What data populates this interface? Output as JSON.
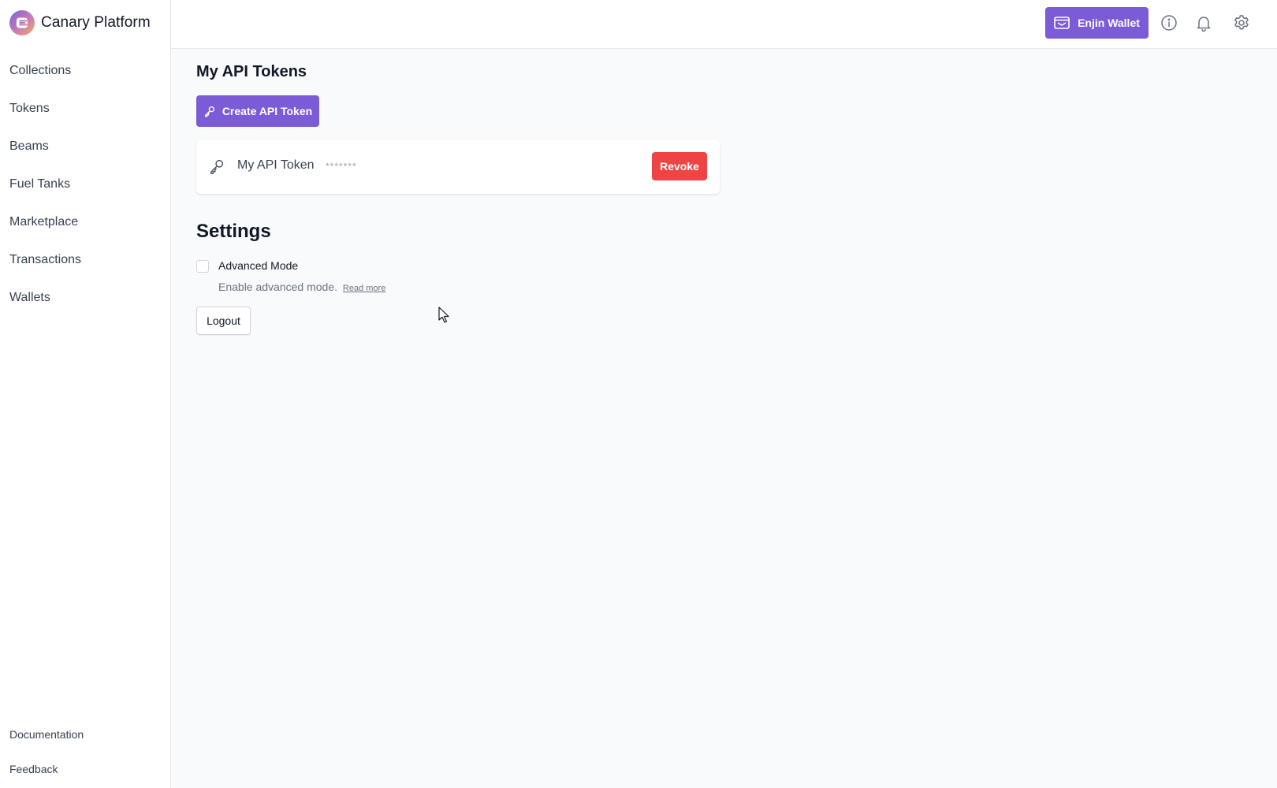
{
  "brand": {
    "name": "Canary Platform",
    "logo_icon": "enjin-logo-icon"
  },
  "sidebar": {
    "items": [
      {
        "label": "Collections"
      },
      {
        "label": "Tokens"
      },
      {
        "label": "Beams"
      },
      {
        "label": "Fuel Tanks"
      },
      {
        "label": "Marketplace"
      },
      {
        "label": "Transactions"
      },
      {
        "label": "Wallets"
      }
    ],
    "bottom_items": [
      {
        "label": "Documentation"
      },
      {
        "label": "Feedback"
      }
    ]
  },
  "topbar": {
    "wallet_button": {
      "label": "Enjin Wallet",
      "icon": "wallet-icon"
    },
    "icons": [
      "info-icon",
      "bell-icon",
      "gear-icon"
    ]
  },
  "main": {
    "title": "My API Tokens",
    "create_button": {
      "label": "Create API Token",
      "icon": "key-icon"
    },
    "tokens": [
      {
        "name": "My API Token",
        "masked_value": "*******",
        "revoke_label": "Revoke"
      }
    ],
    "settings": {
      "title": "Settings",
      "advanced_mode": {
        "label": "Advanced Mode",
        "checked": false,
        "help_text": "Enable advanced mode.",
        "link_text": "Read more"
      },
      "logout_label": "Logout"
    }
  },
  "colors": {
    "accent": "#7c5cd6",
    "danger": "#ef4444",
    "background": "#f9fafb",
    "surface": "#ffffff",
    "border": "#e5e7eb"
  }
}
